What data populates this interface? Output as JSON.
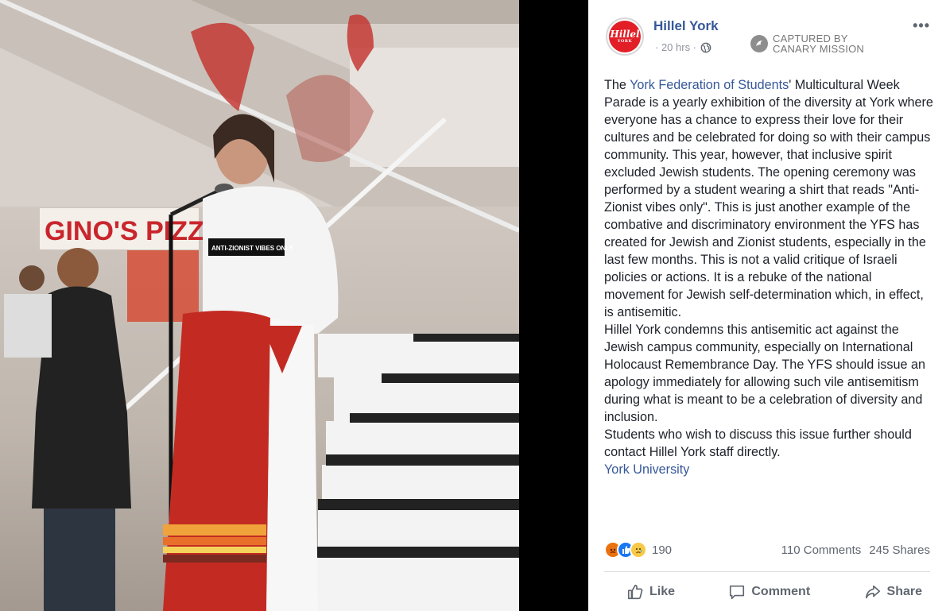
{
  "post": {
    "page_name": "Hillel York",
    "avatar_text": "Hillel",
    "avatar_subtext": "YORK",
    "timestamp": "· 20 hrs ·",
    "more_label": "•••",
    "capture_line1": "CAPTURED BY",
    "capture_line2": "CANARY MISSION",
    "body": {
      "p1_pre": "The ",
      "p1_link": "York Federation of Students",
      "p1_post": "' Multicultural Week Parade is a yearly exhibition of the diversity at York where everyone has a chance to express their love for their cultures and be celebrated for doing so with their campus community. This year, however, that inclusive spirit excluded Jewish students. The opening ceremony was performed by a student wearing a shirt that reads \"Anti-Zionist vibes only\". This is just another example of the combative and discriminatory environment the YFS has created for Jewish and Zionist students, especially in the last few months. This is not a valid critique of Israeli policies or actions. It is a rebuke of the national movement for Jewish self-determination which, in effect, is antisemitic.",
      "p2": "Hillel York condemns this antisemitic act against the Jewish campus community, especially on International Holocaust Remembrance Day. The YFS should issue an apology immediately for allowing such vile antisemitism during what is meant to be a celebration of diversity and inclusion.",
      "p3": "Students who wish to discuss this issue further should contact Hillel York staff directly.",
      "location_link": "York University"
    },
    "reaction_count": "190",
    "comments": "110 Comments",
    "shares": "245 Shares",
    "actions": {
      "like": "Like",
      "comment": "Comment",
      "share": "Share"
    }
  },
  "photo": {
    "shirt_text": "ANTI-ZIONIST VIBES ONLY",
    "sign_text": "GINO'S PIZZA"
  },
  "colors": {
    "link": "#365899",
    "brand_red": "#e21e26",
    "text": "#1d2129",
    "muted": "#606770"
  }
}
